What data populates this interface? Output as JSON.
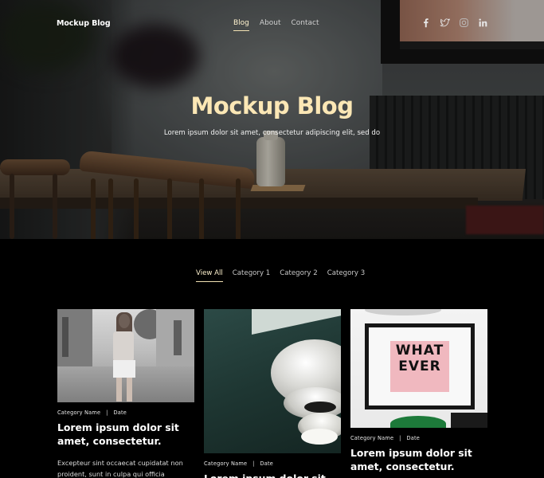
{
  "site": {
    "brand": "Mockup Blog"
  },
  "nav": {
    "items": [
      {
        "label": "Blog",
        "active": true
      },
      {
        "label": "About",
        "active": false
      },
      {
        "label": "Contact",
        "active": false
      }
    ]
  },
  "social": {
    "icons": [
      "facebook-icon",
      "twitter-icon",
      "instagram-icon",
      "linkedin-icon"
    ]
  },
  "hero": {
    "title": "Mockup Blog",
    "subtitle": "Lorem ipsum dolor sit amet, consectetur adipiscing elit, sed do"
  },
  "filters": {
    "items": [
      {
        "label": "View All",
        "active": true
      },
      {
        "label": "Category 1",
        "active": false
      },
      {
        "label": "Category 2",
        "active": false
      },
      {
        "label": "Category 3",
        "active": false
      }
    ]
  },
  "posts": [
    {
      "category": "Category Name",
      "date": "Date",
      "title": "Lorem ipsum dolor sit amet, consectetur.",
      "excerpt": "Excepteur sint occaecat cupidatat non proident, sunt in culpa qui officia"
    },
    {
      "category": "Category Name",
      "date": "Date",
      "title": "Lorem ipsum dolor sit amet, consectetur.",
      "excerpt": ""
    },
    {
      "category": "Category Name",
      "date": "Date",
      "title": "Lorem ipsum dolor sit amet, consectetur.",
      "excerpt": ""
    }
  ],
  "print_art_text": "WHAT EVER",
  "colors": {
    "accent": "#fbe7b5",
    "background": "#000000"
  }
}
